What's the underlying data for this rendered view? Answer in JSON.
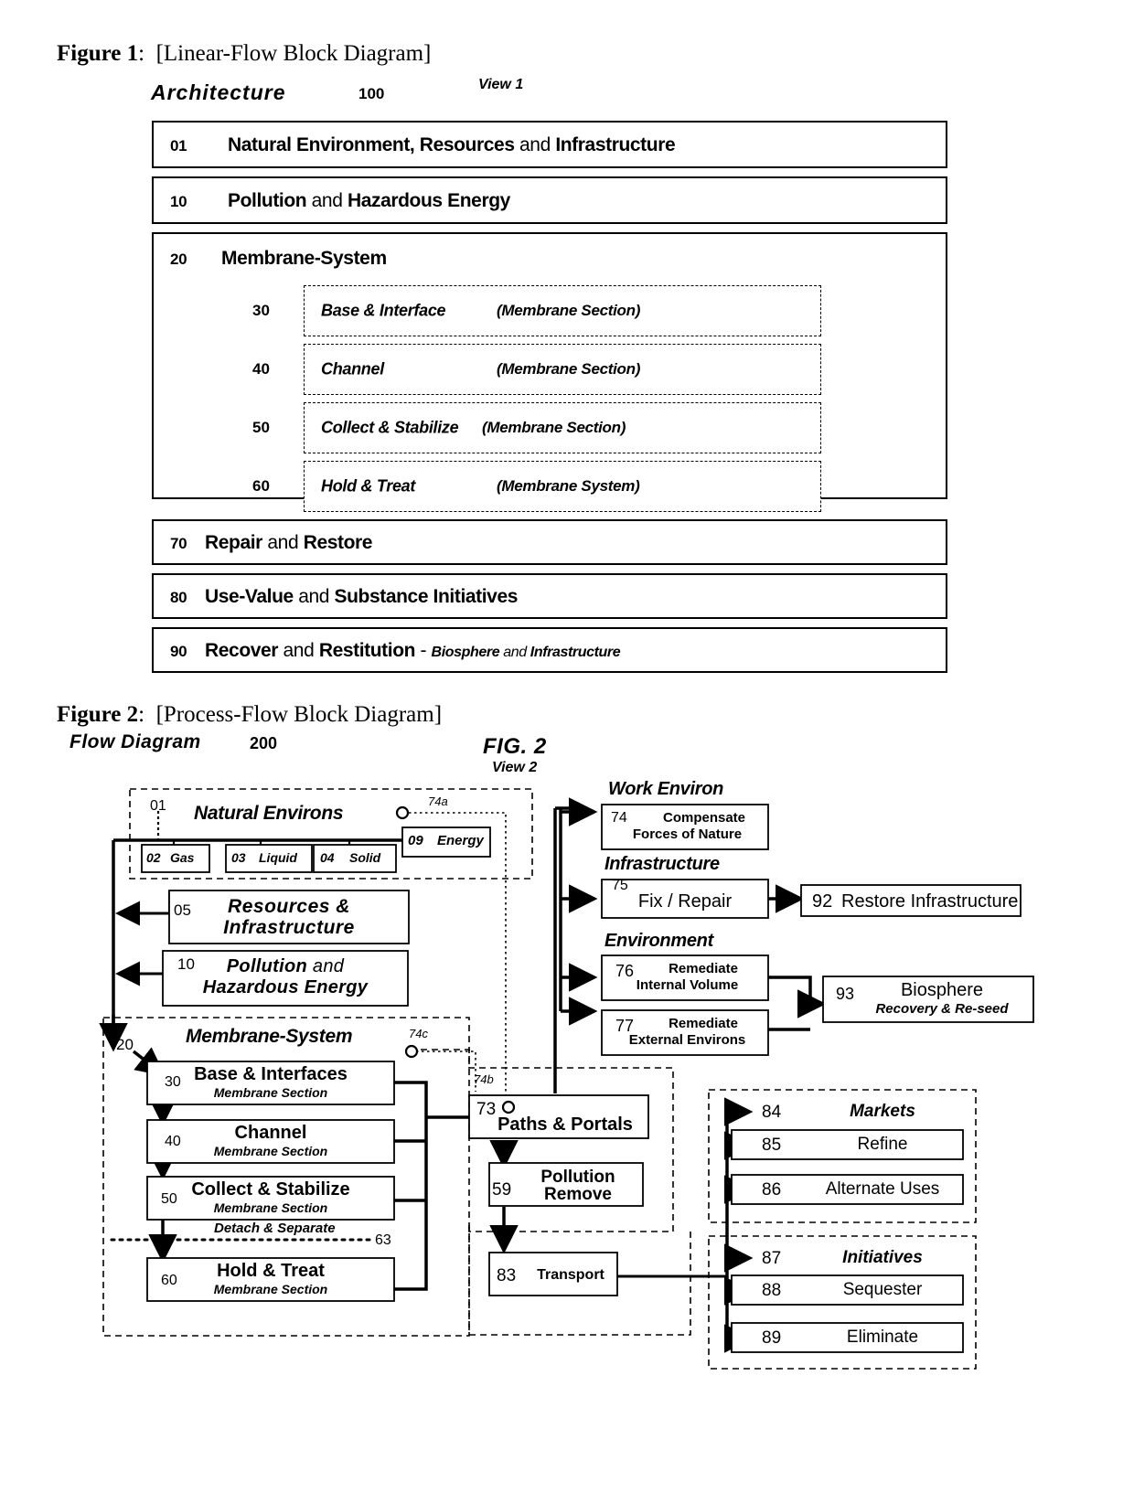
{
  "figure1": {
    "caption_label": "Figure 1",
    "caption_colon": ":",
    "caption_text": "[Linear-Flow Block Diagram]",
    "title": "Architecture",
    "ref": "100",
    "view": "View 1",
    "rows": [
      {
        "num": "01",
        "bold1": "Natural Environment, Resources",
        "light": " and ",
        "bold2": "Infrastructure"
      },
      {
        "num": "10",
        "bold1": "Pollution",
        "light": " and ",
        "bold2": "Hazardous Energy"
      },
      {
        "num": "20",
        "bold1": "Membrane-System",
        "light": "",
        "bold2": ""
      },
      {
        "num": "70",
        "bold1": "Repair",
        "light": " and ",
        "bold2": "Restore"
      },
      {
        "num": "80",
        "bold1": "Use-Value",
        "light": " and ",
        "bold2": "Substance Initiatives"
      },
      {
        "num": "90",
        "bold1": "Recover",
        "light": " and ",
        "bold2": "Restitution",
        "suffix_dash": " - ",
        "suffix_i1": "Biosphere",
        "suffix_lt": " and ",
        "suffix_i2": "Infrastructure"
      }
    ],
    "subsections": [
      {
        "num": "30",
        "title": "Base & Interface",
        "paren": "(Membrane Section)"
      },
      {
        "num": "40",
        "title": "Channel",
        "paren": "(Membrane Section)"
      },
      {
        "num": "50",
        "title": "Collect & Stabilize",
        "paren": "(Membrane Section)"
      },
      {
        "num": "60",
        "title": "Hold & Treat",
        "paren": "(Membrane System)"
      }
    ]
  },
  "figure2": {
    "caption_label": "Figure 2",
    "caption_colon": ":",
    "caption_text": "[Process-Flow Block Diagram]",
    "title": "Flow Diagram",
    "ref": "200",
    "fig_tag": "FIG. 2",
    "view": "View 2",
    "group_natural_environs": "Natural Environs",
    "ref_01": "01",
    "ref_74a": "74a",
    "box_02": {
      "num": "02",
      "label": "Gas"
    },
    "box_03": {
      "num": "03",
      "label": "Liquid"
    },
    "box_04": {
      "num": "04",
      "label": "Solid"
    },
    "box_09": {
      "num": "09",
      "label": "Energy"
    },
    "box_05": {
      "num": "05",
      "line1": "Resources &",
      "line2": "Infrastructure"
    },
    "box_10": {
      "num": "10",
      "bold1": "Pollution",
      "light": " and",
      "line2": "Hazardous Energy"
    },
    "group_membrane_system": "Membrane-System",
    "ref_20": "20",
    "ref_74c": "74c",
    "ref_74b": "74b",
    "box_30": {
      "num": "30",
      "title": "Base & Interfaces",
      "sub": "Membrane Section"
    },
    "box_40": {
      "num": "40",
      "title": "Channel",
      "sub": "Membrane Section"
    },
    "box_50": {
      "num": "50",
      "title": "Collect & Stabilize",
      "sub": "Membrane Section"
    },
    "box_60": {
      "num": "60",
      "title": "Hold & Treat",
      "sub": "Membrane Section"
    },
    "detach_label": "Detach & Separate",
    "ref_63": "63",
    "hdr_work_environ": "Work Environ",
    "hdr_infrastructure": "Infrastructure",
    "hdr_environment": "Environment",
    "box_74": {
      "num": "74",
      "line1": "Compensate",
      "line2": "Forces of Nature"
    },
    "box_75": {
      "num": "75",
      "title": "Fix / Repair"
    },
    "box_92": {
      "num": "92",
      "title": "Restore Infrastructure"
    },
    "box_76": {
      "num": "76",
      "line1": "Remediate",
      "line2": "Internal Volume"
    },
    "box_77": {
      "num": "77",
      "line1": "Remediate",
      "line2": "External Environs"
    },
    "box_93": {
      "num": "93",
      "title": "Biosphere",
      "sub": "Recovery & Re-seed"
    },
    "box_73": {
      "num": "73",
      "title": "Paths & Portals"
    },
    "box_59": {
      "num": "59",
      "line1": "Pollution",
      "line2": "Remove"
    },
    "box_83": {
      "num": "83",
      "title": "Transport"
    },
    "box_84": {
      "num": "84",
      "title": "Markets"
    },
    "box_85": {
      "num": "85",
      "title": "Refine"
    },
    "box_86": {
      "num": "86",
      "title": "Alternate Uses"
    },
    "box_87": {
      "num": "87",
      "title": "Initiatives"
    },
    "box_88": {
      "num": "88",
      "title": "Sequester"
    },
    "box_89": {
      "num": "89",
      "title": "Eliminate"
    }
  }
}
